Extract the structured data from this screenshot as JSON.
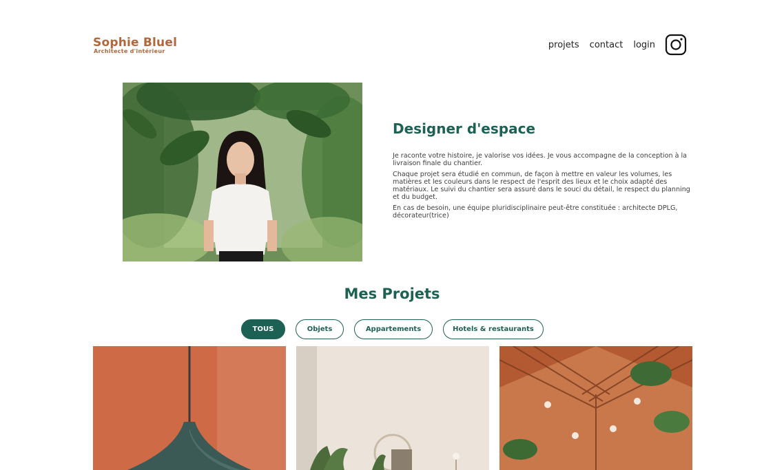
{
  "brand": {
    "name": "Sophie Bluel",
    "subtitle": "Architecte d'intérieur"
  },
  "nav": {
    "items": [
      "projets",
      "contact",
      "login"
    ],
    "social_icon": "instagram-icon"
  },
  "intro": {
    "title": "Designer d'espace",
    "paragraphs": [
      "Je raconte votre histoire, je valorise vos idées. Je vous accompagne de la conception à la livraison finale du chantier.",
      "Chaque projet sera étudié en commun, de façon à mettre en valeur les volumes, les matières et les couleurs dans le respect de l'esprit des lieux et le choix adapté des matériaux. Le suivi du chantier sera assuré dans le souci du détail, le respect du planning et du budget.",
      "En cas de besoin, une équipe pluridisciplinaire peut-être constituée : architecte DPLG, décorateur(trice)"
    ]
  },
  "projects": {
    "title": "Mes Projets",
    "filters": [
      "TOUS",
      "Objets",
      "Appartements",
      "Hotels & restaurants"
    ],
    "active_filter": "TOUS"
  },
  "colors": {
    "primary": "#1d6154",
    "brand": "#b1663c"
  }
}
